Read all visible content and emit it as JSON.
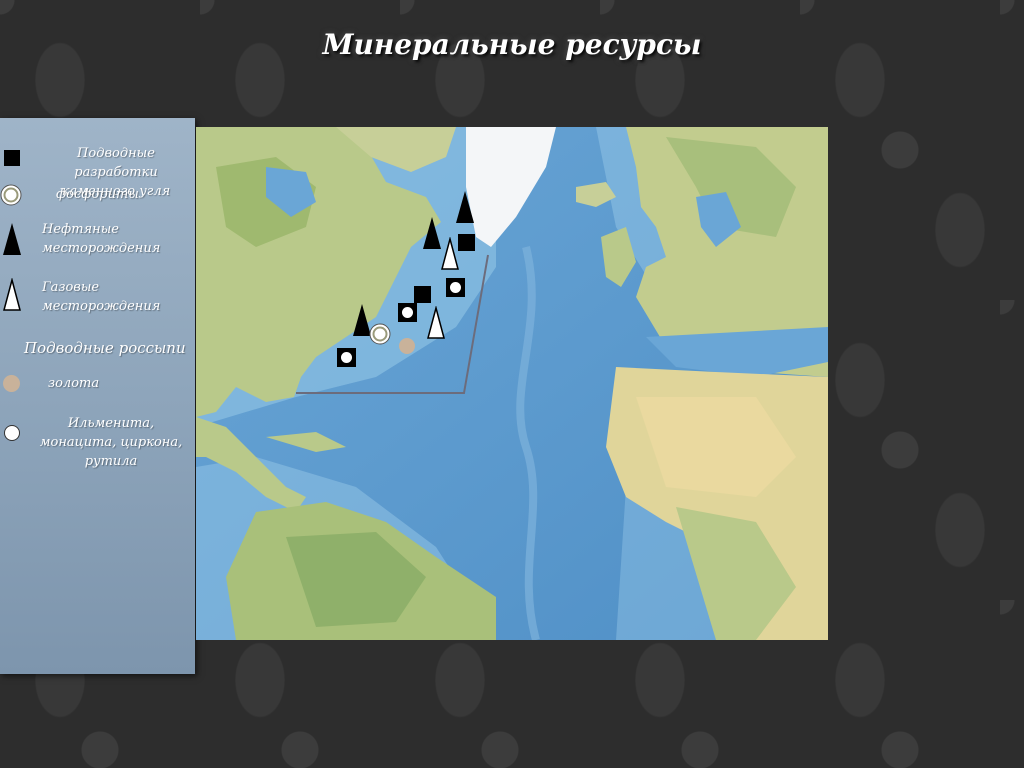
{
  "title": "Минеральные ресурсы",
  "legend": {
    "coal": "Подводные разработки каменного угля",
    "phosphorite": "фосфориты",
    "oil": "Нефтяные месторождения",
    "gas": "Газовые месторождения",
    "placers_header": "Подводные россыпи",
    "gold": "золота",
    "ilmenite": "Ильменита, монацита, циркона, рутила"
  },
  "colors": {
    "ocean": "#5e9ccf",
    "land": "#c8cf8c",
    "legend_panel": "#8ea5bb",
    "gold_marker": "#c9b29a"
  },
  "map": {
    "region": "North Atlantic",
    "markers": [
      {
        "type": "oil"
      },
      {
        "type": "oil"
      },
      {
        "type": "oil"
      },
      {
        "type": "gas"
      },
      {
        "type": "gas"
      },
      {
        "type": "coal"
      },
      {
        "type": "coal"
      },
      {
        "type": "ilmenite"
      },
      {
        "type": "ilmenite"
      },
      {
        "type": "ilmenite"
      },
      {
        "type": "phosphorite"
      },
      {
        "type": "gold"
      }
    ]
  }
}
